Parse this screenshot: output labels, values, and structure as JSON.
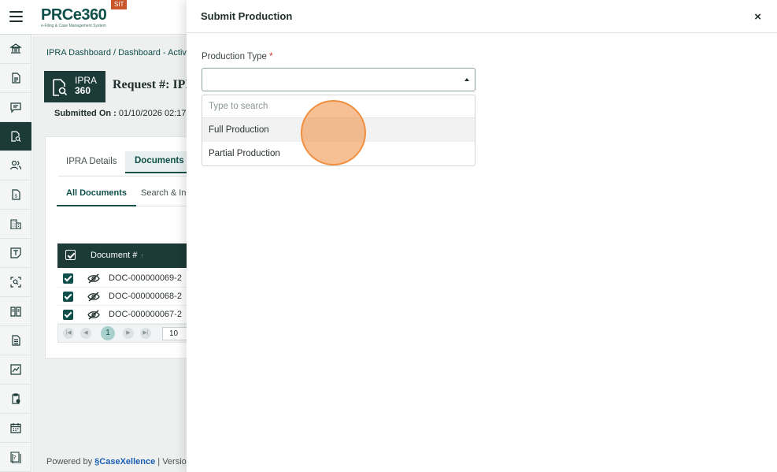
{
  "header": {
    "brand": "PRCe360",
    "tagline": "e-Filing & Case Management System",
    "env_badge": "SIT"
  },
  "sidebar": {
    "items": [
      {
        "icon": "bank-icon"
      },
      {
        "icon": "document-icon"
      },
      {
        "icon": "chat-icon"
      },
      {
        "icon": "document-search-icon",
        "active": true
      },
      {
        "icon": "users-icon"
      },
      {
        "icon": "invoice-icon"
      },
      {
        "icon": "building-icon"
      },
      {
        "icon": "template-icon"
      },
      {
        "icon": "scan-icon"
      },
      {
        "icon": "book-icon"
      },
      {
        "icon": "file-icon"
      },
      {
        "icon": "chart-icon"
      },
      {
        "icon": "clipboard-icon"
      },
      {
        "icon": "calendar-icon"
      },
      {
        "icon": "help-icon"
      }
    ]
  },
  "background": {
    "breadcrumb": "IPRA Dashboard / Dashboard - Activ",
    "ipra_label_1": "IPRA",
    "ipra_label_2": "360",
    "request_title": "Request #: IPR",
    "submitted_label": "Submitted On :",
    "submitted_value": "01/10/2026 02:17",
    "tabs": [
      "IPRA Details",
      "Documents"
    ],
    "subtabs": [
      "All Documents",
      "Search & In"
    ],
    "grid_header": "Document #",
    "rows": [
      "DOC-000000069-2",
      "DOC-000000068-2",
      "DOC-000000067-2"
    ],
    "pager_page": "1",
    "pager_size": "10",
    "footer_powered": "Powered by",
    "footer_brand": "CaseXellence",
    "footer_version": "|  Versio"
  },
  "drawer": {
    "title": "Submit Production",
    "close_symbol": "×",
    "field_label": "Production Type",
    "required_mark": "*",
    "search_placeholder": "Type to search",
    "options": [
      "Full Production",
      "Partial Production"
    ]
  }
}
